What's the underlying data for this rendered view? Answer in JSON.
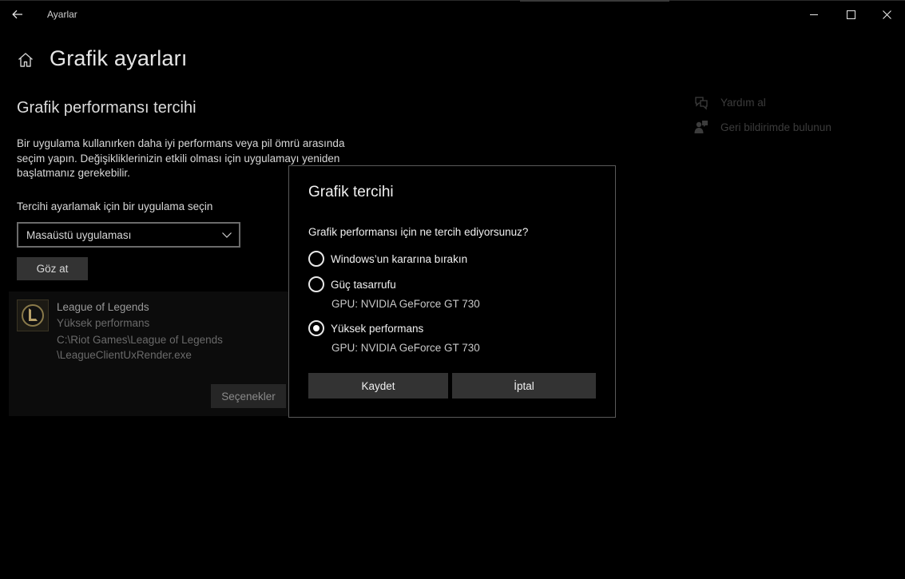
{
  "window": {
    "title": "Ayarlar"
  },
  "page": {
    "title": "Grafik ayarları",
    "section_title": "Grafik performansı tercihi",
    "description_lines": [
      "Bir uygulama kullanırken daha iyi performans veya pil ömrü arasında",
      "seçim yapın. Değişikliklerinizin etkili olması için uygulamayı yeniden",
      "başlatmanız gerekebilir."
    ],
    "select_label": "Tercihi ayarlamak için bir uygulama seçin",
    "dropdown_value": "Masaüstü uygulaması",
    "browse_label": "Göz at"
  },
  "app_card": {
    "name": "League of Legends",
    "preference": "Yüksek performans",
    "path_lines": [
      "C:\\Riot Games\\League of Legends",
      "\\LeagueClientUxRender.exe"
    ],
    "options_label": "Seçenekler"
  },
  "links": {
    "help": "Yardım al",
    "feedback": "Geri bildirimde bulunun"
  },
  "dialog": {
    "title": "Grafik tercihi",
    "question": "Grafik performansı için ne tercih ediyorsunuz?",
    "options": [
      {
        "label": "Windows’un kararına bırakın",
        "gpu": "",
        "checked": false
      },
      {
        "label": "Güç tasarrufu",
        "gpu": "GPU: NVIDIA GeForce GT 730",
        "checked": false
      },
      {
        "label": "Yüksek performans",
        "gpu": "GPU: NVIDIA GeForce GT 730",
        "checked": true
      }
    ],
    "save_label": "Kaydet",
    "cancel_label": "İptal"
  },
  "icons": {
    "back": "back-arrow-icon",
    "home": "home-icon",
    "minimize": "minimize-icon",
    "maximize": "maximize-icon",
    "close": "close-icon",
    "dropdown": "chevron-down-icon",
    "help": "help-chat-icon",
    "feedback": "feedback-person-icon",
    "app": "league-of-legends-logo-icon"
  },
  "colors": {
    "background": "#000000",
    "button": "#333333",
    "dialog_border": "#5a5a5a"
  }
}
